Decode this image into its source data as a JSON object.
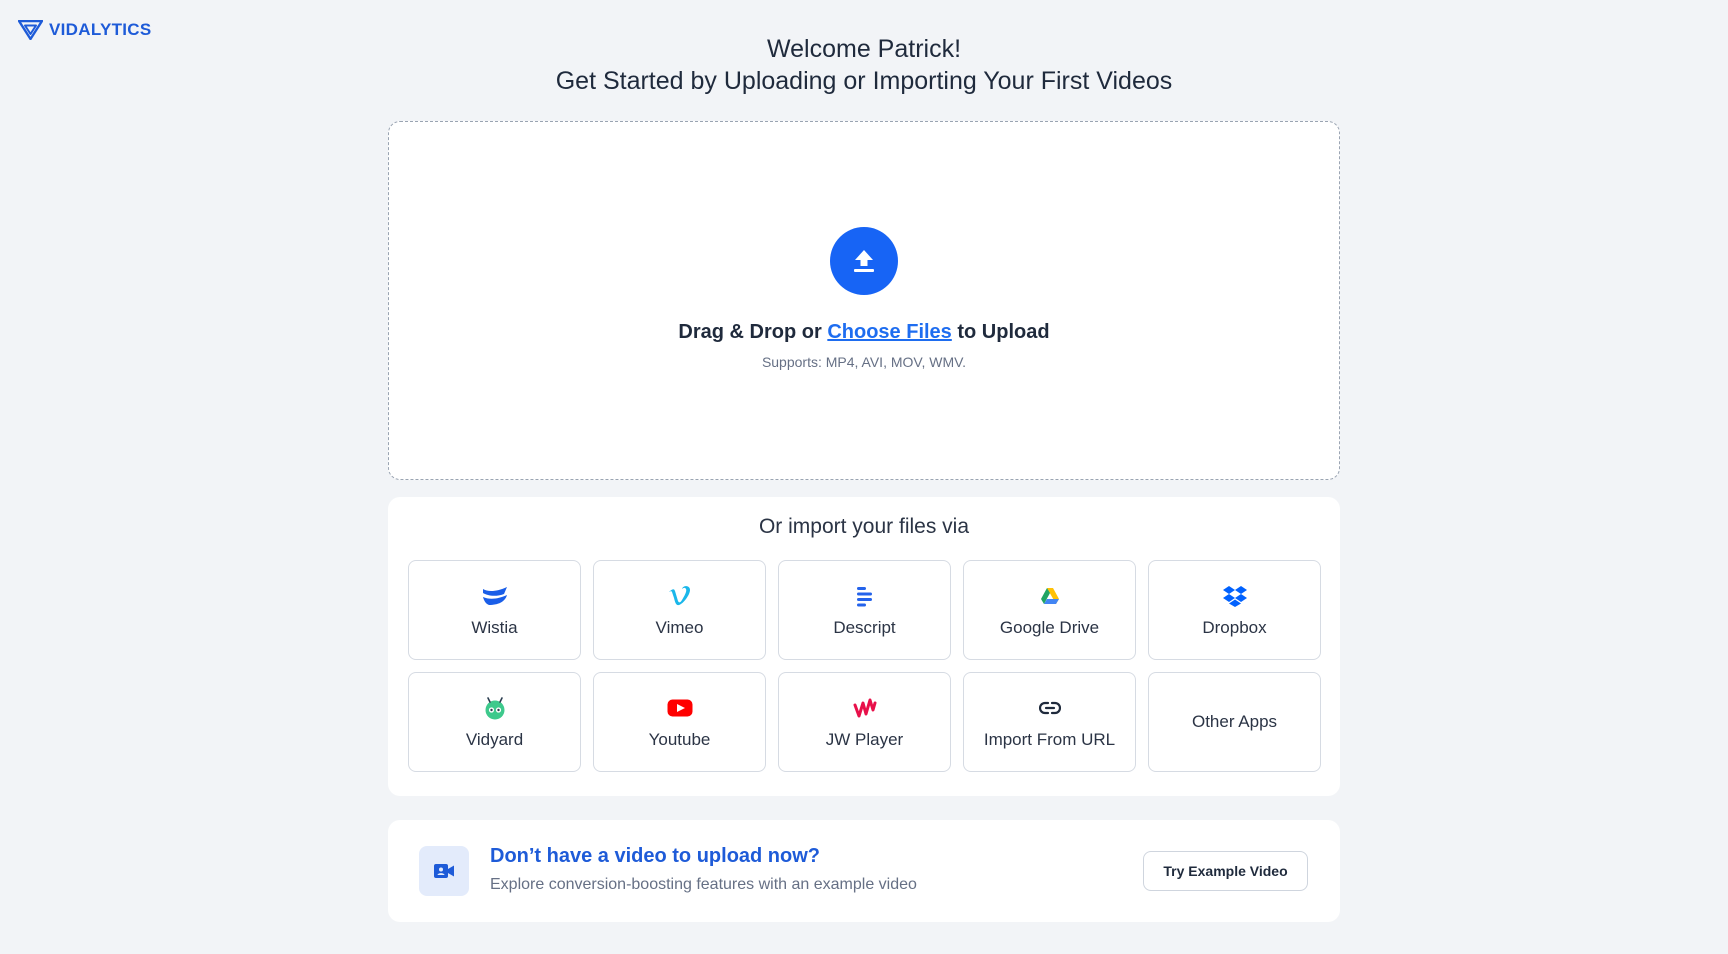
{
  "brand": {
    "name": "VIDALYTICS",
    "color": "#1e5bd8"
  },
  "header": {
    "greeting": "Welcome Patrick!",
    "subtitle": "Get Started by Uploading or Importing Your First Videos"
  },
  "upload": {
    "icon": "upload-arrow-icon",
    "prefix": "Drag & Drop or ",
    "link": "Choose Files",
    "suffix": " to Upload",
    "supports": "Supports: MP4, AVI, MOV, WMV.",
    "accent": "#1764f5"
  },
  "import": {
    "title": "Or import your files via",
    "sources": [
      {
        "label": "Wistia",
        "icon": "wistia-icon"
      },
      {
        "label": "Vimeo",
        "icon": "vimeo-icon"
      },
      {
        "label": "Descript",
        "icon": "descript-icon"
      },
      {
        "label": "Google Drive",
        "icon": "google-drive-icon"
      },
      {
        "label": "Dropbox",
        "icon": "dropbox-icon"
      },
      {
        "label": "Vidyard",
        "icon": "vidyard-icon"
      },
      {
        "label": "Youtube",
        "icon": "youtube-icon"
      },
      {
        "label": "JW Player",
        "icon": "jw-player-icon"
      },
      {
        "label": "Import From URL",
        "icon": "link-icon"
      },
      {
        "label": "Other Apps",
        "icon": ""
      }
    ]
  },
  "example": {
    "icon": "video-camera-icon",
    "title": "Don’t have a video to upload now?",
    "subtitle": "Explore conversion-boosting features with an example video",
    "button": "Try Example Video"
  }
}
